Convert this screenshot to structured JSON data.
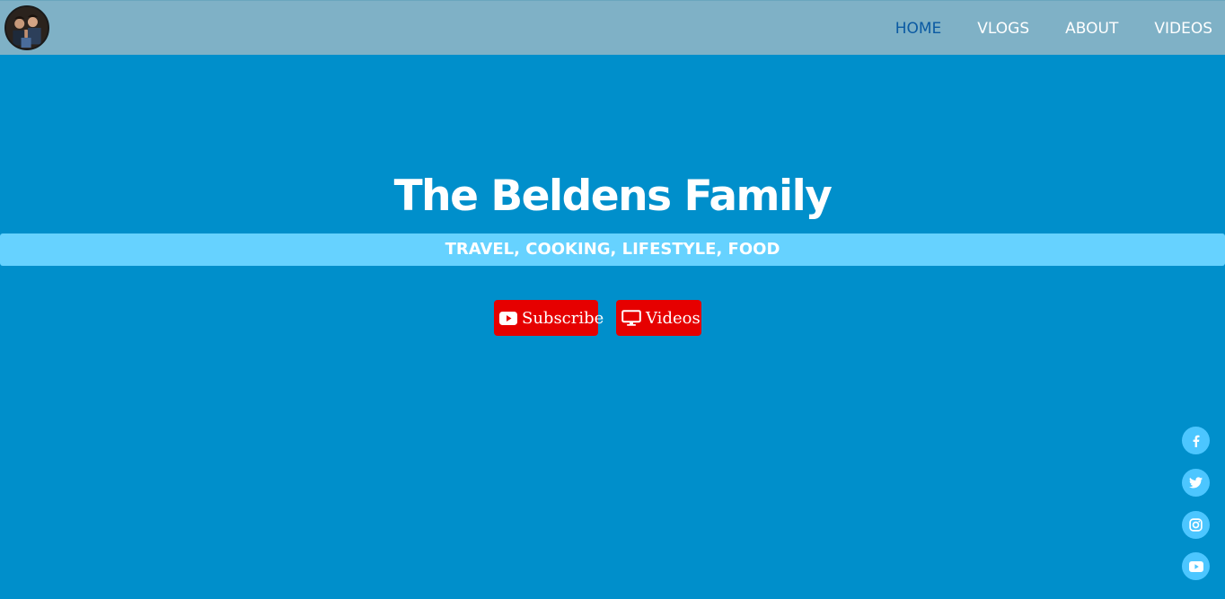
{
  "nav": {
    "avatar_alt": "family photo",
    "links": [
      {
        "label": "HOME",
        "active": true
      },
      {
        "label": "VLOGS",
        "active": false
      },
      {
        "label": "ABOUT",
        "active": false
      },
      {
        "label": "VIDEOS",
        "active": false
      }
    ]
  },
  "hero": {
    "title": "The Beldens Family",
    "tagline": "TRAVEL, COOKING, LIFESTYLE, FOOD",
    "buttons": {
      "subscribe_label": "Subscribe",
      "subscribe_icon": "youtube-icon",
      "videos_label": "Videos",
      "videos_icon": "monitor-icon"
    }
  },
  "social": [
    {
      "name": "facebook-icon"
    },
    {
      "name": "twitter-icon"
    },
    {
      "name": "instagram-icon"
    },
    {
      "name": "youtube-icon"
    }
  ],
  "colors": {
    "background": "#008fcb",
    "navbar": "#7fb1c6",
    "active_link": "#0b5aa3",
    "tagline_bar": "#66d2ff",
    "button": "#e60000",
    "social_circle": "#4cc6ff"
  }
}
